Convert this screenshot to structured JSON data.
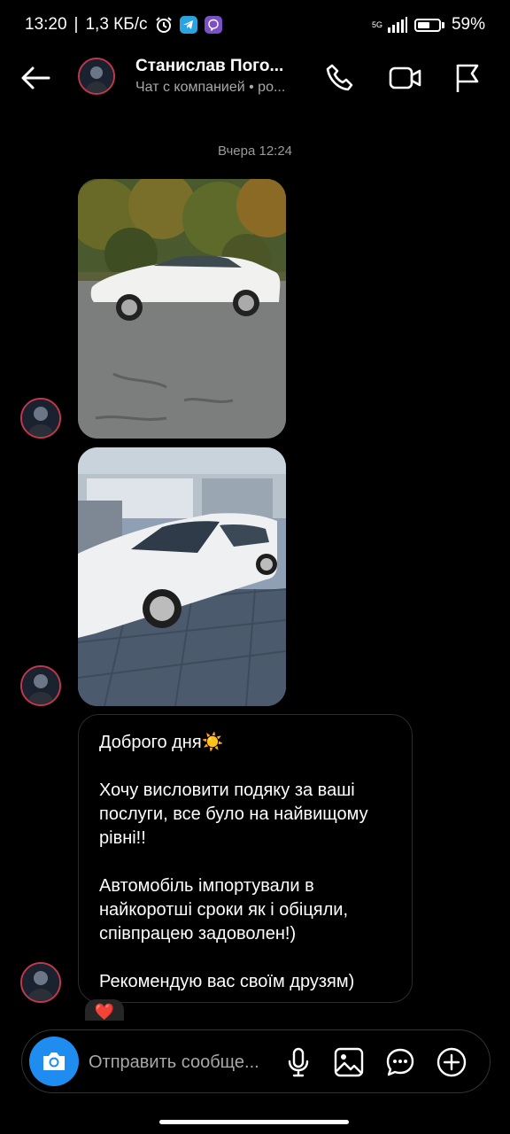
{
  "status_bar": {
    "time": "13:20",
    "speed": "1,3 КБ/с",
    "network": "5G",
    "battery": "59%",
    "battery_level": 0.59
  },
  "header": {
    "contact_name": "Станислав Пого...",
    "subtitle": "Чат с компанией • ро..."
  },
  "chat": {
    "timestamp": "Вчера 12:24",
    "message": {
      "line1": "Доброго дня☀️",
      "line2": "Хочу висловити подяку за ваші послуги, все було на найвищому рівні!!",
      "line3": "Автомобіль імпортували в найкоротші сроки як і обіцяли, співпрацею задоволен!)",
      "line4": "Рекомендую вас своїм друзям)"
    },
    "reaction": "❤️"
  },
  "composer": {
    "placeholder": "Отправить сообще..."
  },
  "colors": {
    "accent": "#1f8cf0",
    "avatar_ring": "#c0384b",
    "bubble_border": "#2b2b2b",
    "muted_text": "#a8a8a8"
  }
}
